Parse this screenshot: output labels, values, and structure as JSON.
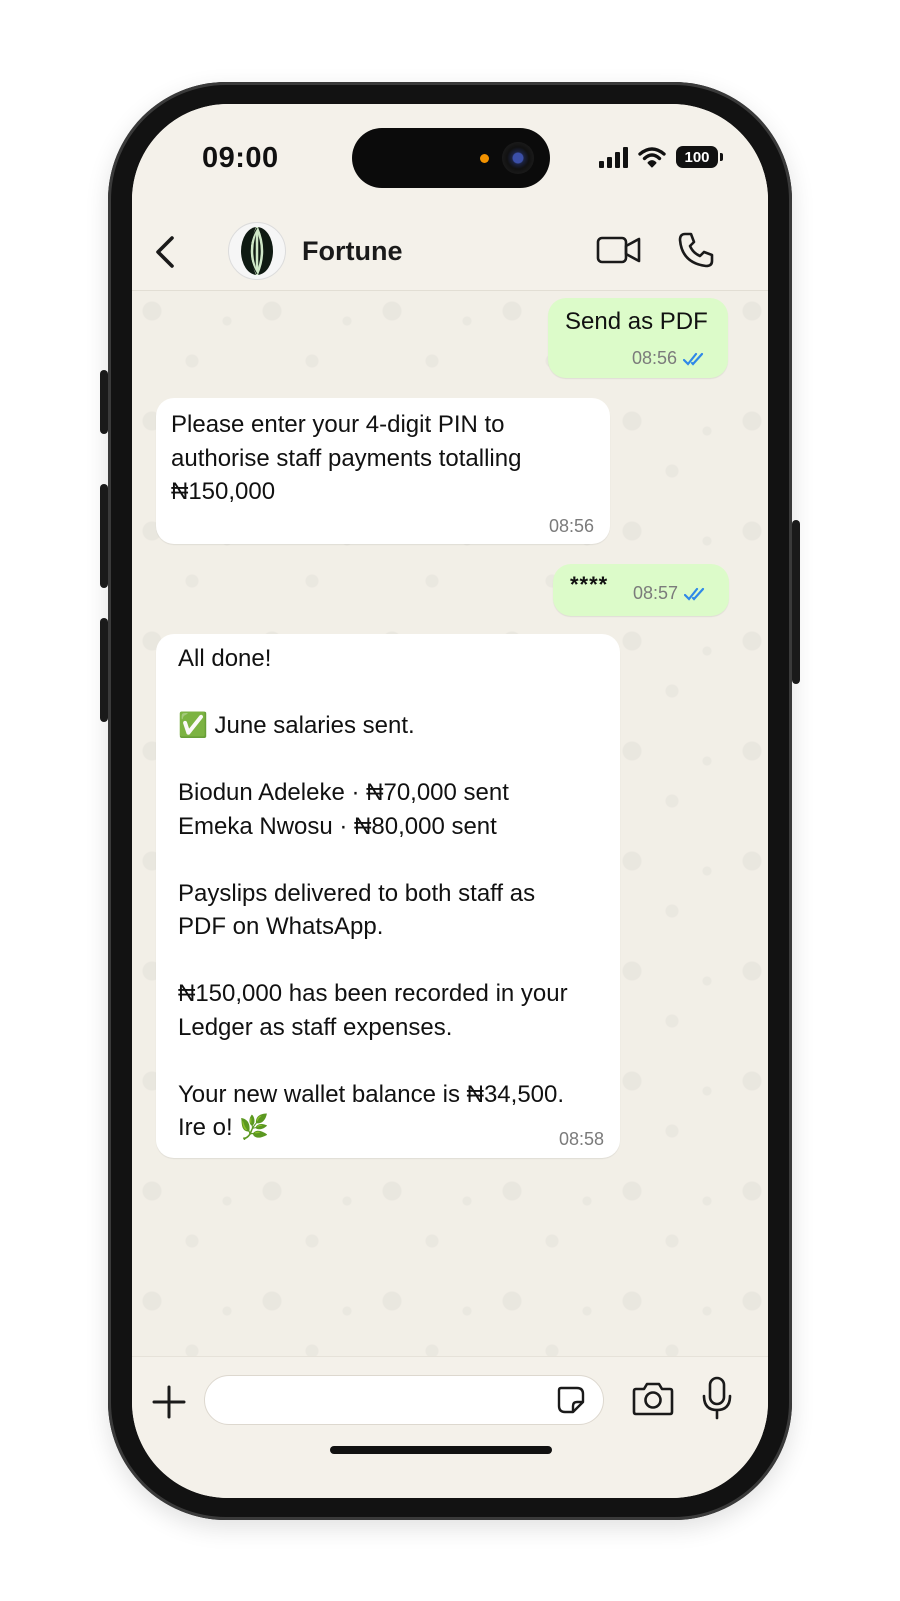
{
  "status_bar": {
    "time": "09:00",
    "battery": "100"
  },
  "header": {
    "contact_name": "Fortune"
  },
  "messages": [
    {
      "direction": "outgoing",
      "text": "Send as PDF",
      "time": "08:56",
      "read": true
    },
    {
      "direction": "incoming",
      "text": "Please enter your 4-digit PIN to\nauthorise staff payments totalling\n₦150,000",
      "time": "08:56"
    },
    {
      "direction": "outgoing",
      "text": "****",
      "time": "08:57",
      "read": true
    },
    {
      "direction": "incoming",
      "text": "All done!\n\n✅ June salaries sent.\n\nBiodun Adeleke · ₦70,000 sent\nEmeka Nwosu · ₦80,000 sent\n\nPayslips delivered to both staff as\nPDF on WhatsApp.\n\n₦150,000 has been recorded in your\nLedger as staff expenses.\n\nYour new wallet balance is ₦34,500.\nIre o! 🌿",
      "time": "08:58"
    }
  ],
  "icons": {
    "back": "chevron-left-icon",
    "video": "video-camera-icon",
    "call": "phone-icon",
    "attach": "plus-icon",
    "sticker": "sticker-icon",
    "camera": "camera-icon",
    "mic": "microphone-icon",
    "read_receipt": "double-check-icon"
  },
  "colors": {
    "outgoing_bubble": "#dcfbc9",
    "incoming_bubble": "#ffffff",
    "chat_background": "#f2efe7",
    "read_receipt": "#2f88e8"
  }
}
